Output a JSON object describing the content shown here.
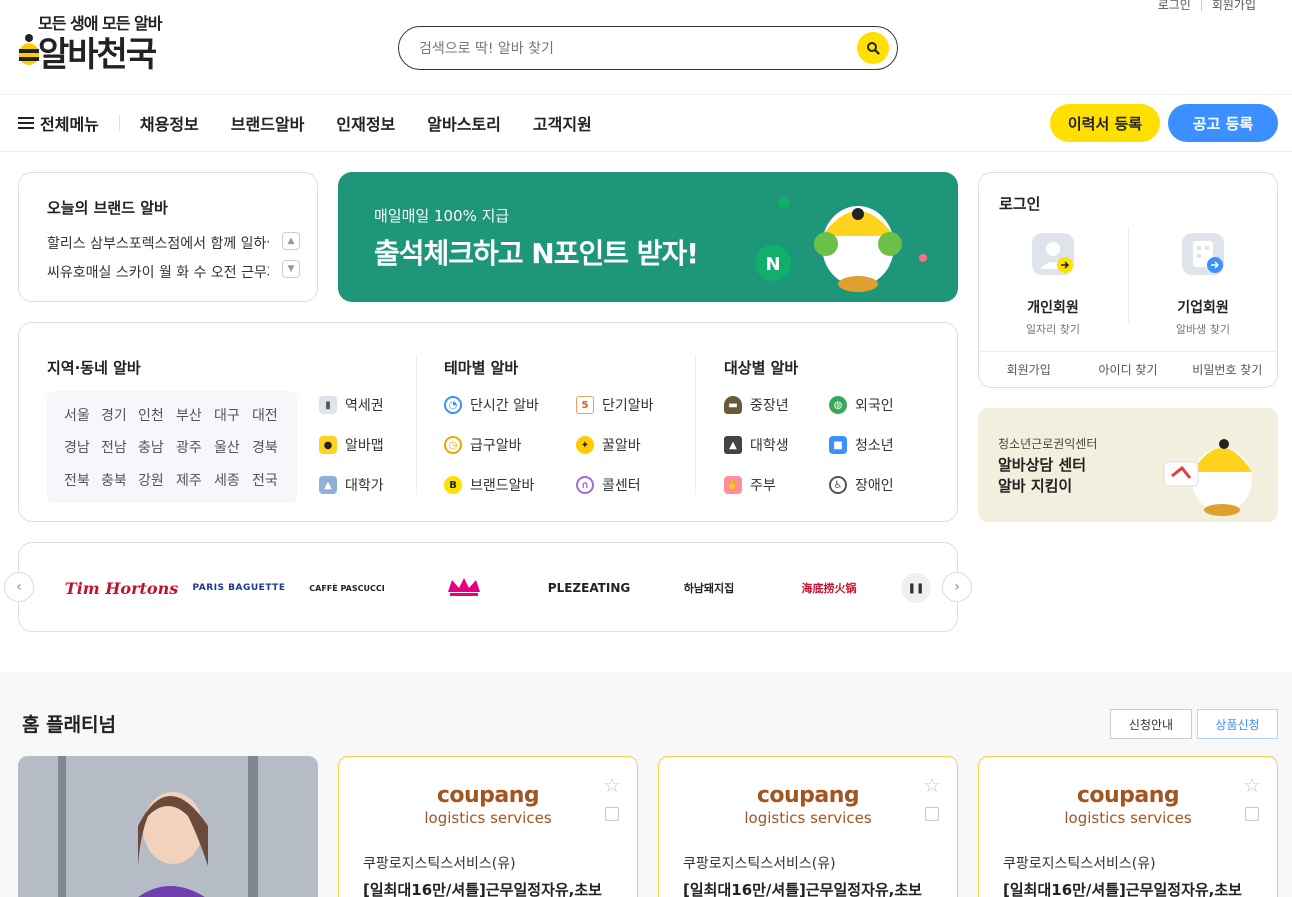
{
  "header": {
    "login_link": "로그인",
    "signup_link": "회원가입",
    "logo_tagline": "모든 생애 모든 알바",
    "logo_name": "알바천국",
    "search_placeholder": "검색으로 딱! 알바 찾기"
  },
  "nav": {
    "menu_label": "전체메뉴",
    "items": [
      "채용정보",
      "브랜드알바",
      "인재정보",
      "알바스토리",
      "고객지원"
    ],
    "resume_button": "이력서 등록",
    "post_button": "공고 등록"
  },
  "brand_alba": {
    "title": "오늘의 브랜드 알바",
    "items": [
      "할리스 삼부스포렉스점에서 함께 일하실 분을 모십니다",
      "씨유호매실 스카이 월 화 수 오전 근무자 모집"
    ]
  },
  "banner": {
    "subtitle": "매일매일 100% 지급",
    "title": "출석체크하고 N포인트 받자!"
  },
  "login": {
    "title": "로그인",
    "personal": {
      "name": "개인회원",
      "desc": "일자리 찾기"
    },
    "company": {
      "name": "기업회원",
      "desc": "알바생 찾기"
    },
    "links": [
      "회원가입",
      "아이디 찾기",
      "비밀번호 찾기"
    ]
  },
  "counsel": {
    "subtitle": "청소년근로권익센터",
    "line1": "알바상담 센터",
    "line2": "알바 지킴이"
  },
  "categories": {
    "region_title": "지역·동네 알바",
    "regions": [
      "서울",
      "경기",
      "인천",
      "부산",
      "대구",
      "대전",
      "경남",
      "전남",
      "충남",
      "광주",
      "울산",
      "경북",
      "전북",
      "충북",
      "강원",
      "제주",
      "세종",
      "전국"
    ],
    "region_extras": [
      "역세권",
      "알바맵",
      "대학가"
    ],
    "theme_title": "테마별 알바",
    "themes": [
      "단시간 알바",
      "단기알바",
      "급구알바",
      "꿀알바",
      "브랜드알바",
      "콜센터"
    ],
    "target_title": "대상별 알바",
    "targets": [
      "중장년",
      "외국인",
      "대학생",
      "청소년",
      "주부",
      "장애인"
    ]
  },
  "brand_logos": [
    "Tim Hortons",
    "PARIS BAGUETTE",
    "CAFFÈ PASCUCCI",
    "Paris Baguette crown",
    "PLEZEATING",
    "하남돼지집",
    "海底捞火锅"
  ],
  "platinum": {
    "title": "홈 플래티넘",
    "guide_button": "신청안내",
    "apply_button": "상품신청",
    "cards": [
      {
        "logo_top": "coupang",
        "logo_bottom": "logistics services",
        "company": "쿠팡로지스틱스서비스(유)",
        "title": "[일최대16만/셔틀]근무일정자유,초보"
      },
      {
        "logo_top": "coupang",
        "logo_bottom": "logistics services",
        "company": "쿠팡로지스틱스서비스(유)",
        "title": "[일최대16만/셔틀]근무일정자유,초보"
      },
      {
        "logo_top": "coupang",
        "logo_bottom": "logistics services",
        "company": "쿠팡로지스틱스서비스(유)",
        "title": "[일최대16만/셔틀]근무일정자유,초보"
      }
    ]
  },
  "colors": {
    "accent_yellow": "#ffe000",
    "accent_blue": "#3b8fff",
    "banner_green": "#1d9679"
  }
}
